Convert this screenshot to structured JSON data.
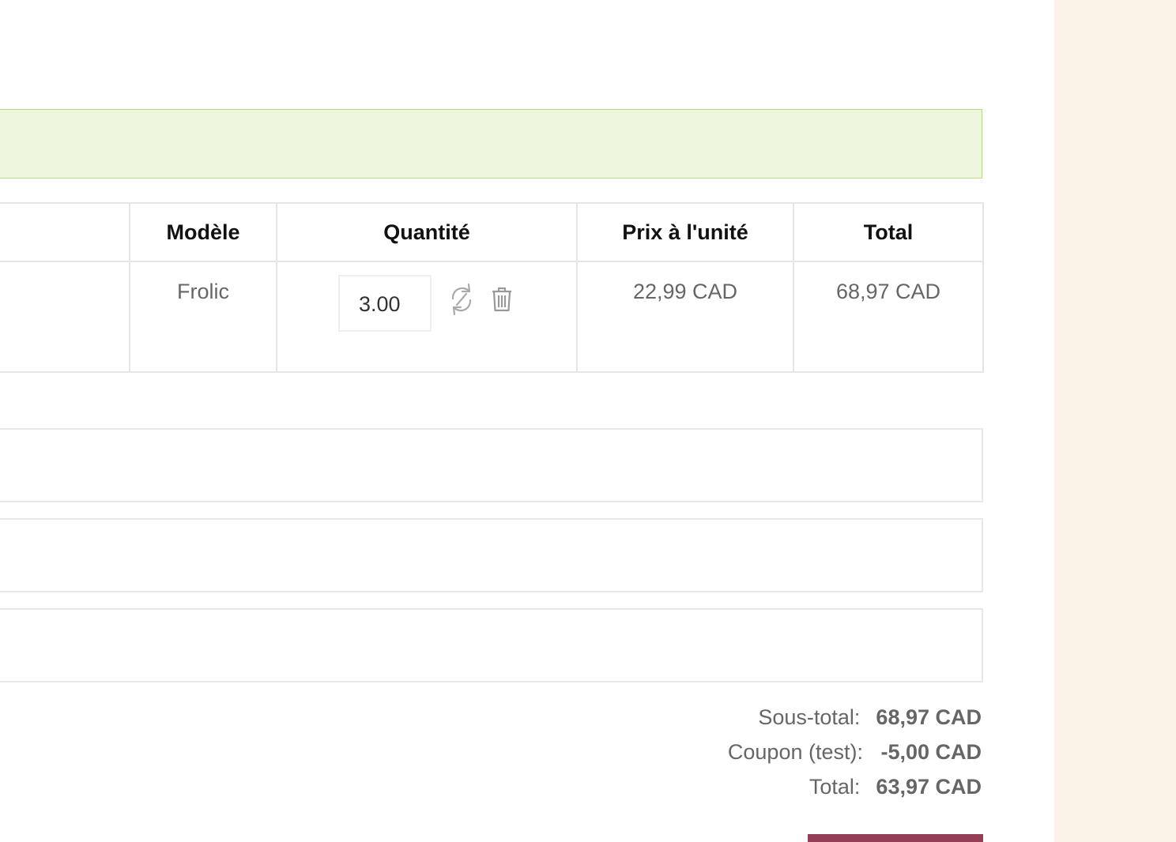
{
  "colors": {
    "alert_background": "#edf5dd",
    "alert_border": "#b9d98e",
    "sidebar_background": "#fbf2e8",
    "checkout_button": "#943f57",
    "table_border": "#e5e5e5"
  },
  "cart_table": {
    "headers": {
      "model": "Modèle",
      "quantity": "Quantité",
      "unit_price": "Prix à l'unité",
      "total": "Total"
    },
    "rows": [
      {
        "model": "Frolic",
        "quantity": "3.00",
        "unit_price": "22,99 CAD",
        "total": "68,97 CAD",
        "actions": {
          "refresh_icon": "refresh-icon",
          "delete_icon": "trash-icon"
        }
      }
    ]
  },
  "totals": {
    "subtotal_label": "Sous-total:",
    "subtotal_value": "68,97 CAD",
    "coupon_label": "Coupon (test):",
    "coupon_value": "-5,00 CAD",
    "total_label": "Total:",
    "total_value": "63,97 CAD"
  }
}
